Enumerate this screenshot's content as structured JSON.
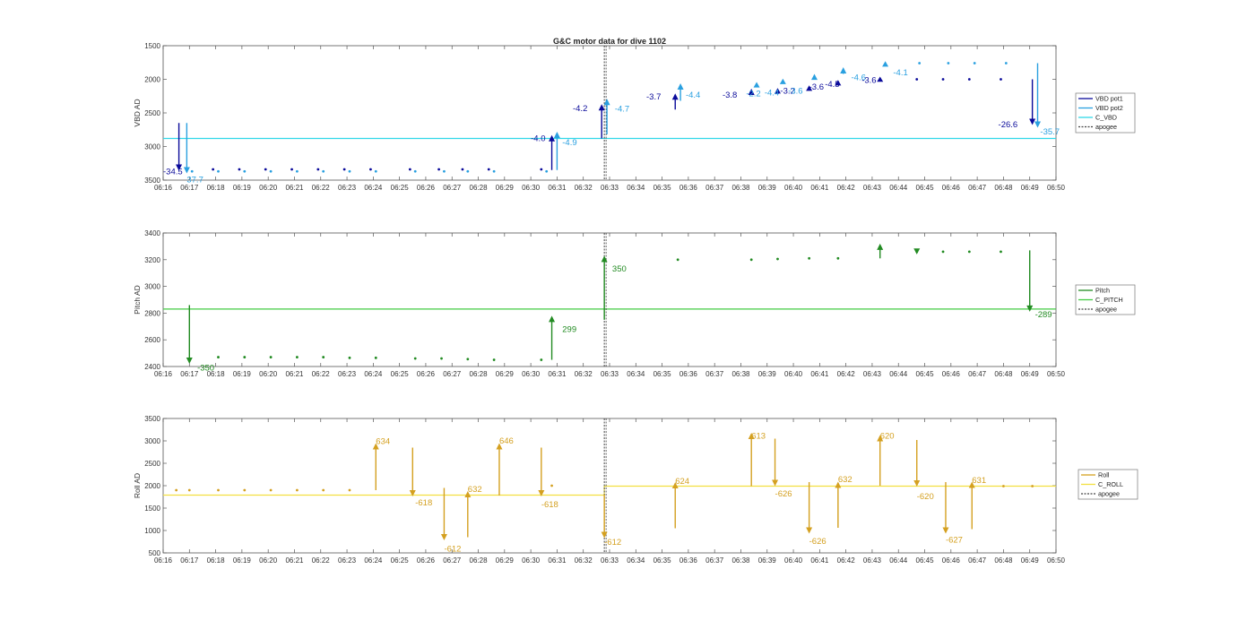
{
  "title": "G&C motor data for dive 1102",
  "time_ticks": [
    "06:16",
    "06:17",
    "06:18",
    "06:19",
    "06:20",
    "06:21",
    "06:22",
    "06:23",
    "06:24",
    "06:25",
    "06:26",
    "06:27",
    "06:28",
    "06:29",
    "06:30",
    "06:31",
    "06:32",
    "06:33",
    "06:34",
    "06:35",
    "06:36",
    "06:37",
    "06:38",
    "06:39",
    "06:40",
    "06:41",
    "06:42",
    "06:43",
    "06:44",
    "06:45",
    "06:46",
    "06:47",
    "06:48",
    "06:49",
    "06:50"
  ],
  "colors": {
    "vbd_pot1": "#0a0a9a",
    "vbd_pot2": "#2aa0e0",
    "c_vbd": "#30d8e8",
    "pitch": "#228b22",
    "c_pitch": "#44cc44",
    "roll": "#d4a020",
    "c_roll": "#f2e040",
    "apogee": "#444444"
  },
  "chart_data": [
    {
      "type": "line",
      "id": "vbd",
      "ylabel": "VBD AD",
      "ylim": [
        1500,
        3500
      ],
      "y_reversed": true,
      "yticks": [
        1500,
        2000,
        2500,
        3000,
        3500
      ],
      "xlim": [
        "06:16",
        "06:50"
      ],
      "apogee": "06:32.8",
      "legend": [
        "VBD pot1",
        "VBD pot2",
        "C_VBD",
        "apogee"
      ],
      "legend_placement": "right",
      "c_line": [
        {
          "x": "06:16",
          "y": 2880
        },
        {
          "x": "06:50",
          "y": 2880
        }
      ],
      "pot1_dots": [
        {
          "x": "06:16.9",
          "y": 3340
        },
        {
          "x": "06:17.9",
          "y": 3340
        },
        {
          "x": "06:18.9",
          "y": 3340
        },
        {
          "x": "06:19.9",
          "y": 3340
        },
        {
          "x": "06:20.9",
          "y": 3340
        },
        {
          "x": "06:21.9",
          "y": 3340
        },
        {
          "x": "06:22.9",
          "y": 3340
        },
        {
          "x": "06:23.9",
          "y": 3340
        },
        {
          "x": "06:25.4",
          "y": 3340
        },
        {
          "x": "06:26.5",
          "y": 3340
        },
        {
          "x": "06:27.4",
          "y": 3340
        },
        {
          "x": "06:28.4",
          "y": 3340
        },
        {
          "x": "06:30.4",
          "y": 3340
        },
        {
          "x": "06:38.4",
          "y": 2200
        },
        {
          "x": "06:39.4",
          "y": 2180
        },
        {
          "x": "06:40.6",
          "y": 2130
        },
        {
          "x": "06:41.7",
          "y": 2060
        },
        {
          "x": "06:43.3",
          "y": 2000
        },
        {
          "x": "06:44.7",
          "y": 2000
        },
        {
          "x": "06:45.7",
          "y": 2000
        },
        {
          "x": "06:46.7",
          "y": 2000
        },
        {
          "x": "06:47.9",
          "y": 2000
        }
      ],
      "pot2_dots": [
        {
          "x": "06:17.1",
          "y": 3370
        },
        {
          "x": "06:18.1",
          "y": 3370
        },
        {
          "x": "06:19.1",
          "y": 3370
        },
        {
          "x": "06:20.1",
          "y": 3370
        },
        {
          "x": "06:21.1",
          "y": 3370
        },
        {
          "x": "06:22.1",
          "y": 3370
        },
        {
          "x": "06:23.1",
          "y": 3370
        },
        {
          "x": "06:24.1",
          "y": 3370
        },
        {
          "x": "06:25.6",
          "y": 3370
        },
        {
          "x": "06:26.7",
          "y": 3370
        },
        {
          "x": "06:27.6",
          "y": 3370
        },
        {
          "x": "06:28.6",
          "y": 3370
        },
        {
          "x": "06:30.6",
          "y": 3370
        },
        {
          "x": "06:44.8",
          "y": 1760
        },
        {
          "x": "06:45.9",
          "y": 1760
        },
        {
          "x": "06:46.9",
          "y": 1760
        },
        {
          "x": "06:48.1",
          "y": 1760
        }
      ],
      "moves": [
        {
          "x": "06:16.6",
          "from": 2650,
          "to": 3360,
          "series": "pot1",
          "label": "-34.5",
          "lx": "06:16.0",
          "ly": 3370
        },
        {
          "x": "06:16.9",
          "from": 2650,
          "to": 3400,
          "series": "pot2",
          "label": "37.7",
          "lx": "06:16.9",
          "ly": 3490
        },
        {
          "x": "06:30.8",
          "from": 3350,
          "to": 2830,
          "series": "pot1",
          "label": "-4.0",
          "lx": "06:30.0",
          "ly": 2880
        },
        {
          "x": "06:31.0",
          "from": 3350,
          "to": 2780,
          "series": "pot2",
          "label": "-4.9",
          "lx": "06:31.2",
          "ly": 2940
        },
        {
          "x": "06:32.7",
          "from": 2880,
          "to": 2370,
          "series": "pot1",
          "label": "-4.2",
          "lx": "06:31.6",
          "ly": 2430
        },
        {
          "x": "06:32.9",
          "from": 2820,
          "to": 2290,
          "series": "pot2",
          "label": "-4.7",
          "lx": "06:33.2",
          "ly": 2440
        },
        {
          "x": "06:35.5",
          "from": 2450,
          "to": 2210,
          "series": "pot1",
          "label": "-3.7",
          "lx": "06:34.4",
          "ly": 2260
        },
        {
          "x": "06:35.7",
          "from": 2320,
          "to": 2060,
          "series": "pot2",
          "label": "-4.4",
          "lx": "06:35.9",
          "ly": 2230
        },
        {
          "x": "06:38.4",
          "from": 2230,
          "to": 2140,
          "series": "pot1",
          "label": "-3.8",
          "lx": "06:37.3",
          "ly": 2230
        },
        {
          "x": "06:38.6",
          "from": 2110,
          "to": 2040,
          "series": "pot2",
          "label": "-2.2",
          "lx": "06:38.2",
          "ly": 2210
        },
        {
          "x": "06:39.4",
          "from": 2200,
          "to": 2130,
          "series": "pot1",
          "label": "-3.2",
          "lx": "06:39.5",
          "ly": 2170
        },
        {
          "x": "06:39.6",
          "from": 2060,
          "to": 1990,
          "series": "pot2",
          "label": "-4.4",
          "lx": "06:38.9",
          "ly": 2200
        },
        {
          "x": "06:40.6",
          "from": 2160,
          "to": 2090,
          "series": "pot1",
          "label": "-3.6",
          "lx": "06:40.6",
          "ly": 2110
        },
        {
          "x": "06:40.8",
          "from": 2000,
          "to": 1920,
          "series": "pot2",
          "label": "-3.6",
          "lx": "06:39.8",
          "ly": 2170
        },
        {
          "x": "06:41.7",
          "from": 2080,
          "to": 2010,
          "series": "pot1",
          "label": "-4.5",
          "lx": "06:41.2",
          "ly": 2070
        },
        {
          "x": "06:41.9",
          "from": 1920,
          "to": 1820,
          "series": "pot2",
          "label": "-4.6",
          "lx": "06:42.2",
          "ly": 1970
        },
        {
          "x": "06:43.3",
          "from": 2020,
          "to": 1960,
          "series": "pot1",
          "label": "-3.6",
          "lx": "06:42.6",
          "ly": 2010
        },
        {
          "x": "06:43.5",
          "from": 1800,
          "to": 1730,
          "series": "pot2",
          "label": "-4.1",
          "lx": "06:43.8",
          "ly": 1900
        },
        {
          "x": "06:49.1",
          "from": 2000,
          "to": 2680,
          "series": "pot1",
          "label": "-26.6",
          "lx": "06:47.8",
          "ly": 2670
        },
        {
          "x": "06:49.3",
          "from": 1760,
          "to": 2720,
          "series": "pot2",
          "label": "-35.7",
          "lx": "06:49.4",
          "ly": 2780
        }
      ]
    },
    {
      "type": "line",
      "id": "pitch",
      "ylabel": "Pitch AD",
      "ylim": [
        2400,
        3400
      ],
      "y_reversed": false,
      "yticks": [
        2400,
        2600,
        2800,
        3000,
        3200,
        3400
      ],
      "xlim": [
        "06:16",
        "06:50"
      ],
      "apogee": "06:32.8",
      "legend": [
        "Pitch",
        "C_PITCH",
        "apogee"
      ],
      "legend_placement": "right",
      "c_line": [
        {
          "x": "06:16",
          "y": 2830
        },
        {
          "x": "06:50",
          "y": 2830
        }
      ],
      "dots": [
        {
          "x": "06:18.1",
          "y": 2470
        },
        {
          "x": "06:19.1",
          "y": 2470
        },
        {
          "x": "06:20.1",
          "y": 2470
        },
        {
          "x": "06:21.1",
          "y": 2470
        },
        {
          "x": "06:22.1",
          "y": 2470
        },
        {
          "x": "06:23.1",
          "y": 2465
        },
        {
          "x": "06:24.1",
          "y": 2465
        },
        {
          "x": "06:25.6",
          "y": 2460
        },
        {
          "x": "06:26.6",
          "y": 2460
        },
        {
          "x": "06:27.6",
          "y": 2455
        },
        {
          "x": "06:28.6",
          "y": 2450
        },
        {
          "x": "06:30.4",
          "y": 2450
        },
        {
          "x": "06:35.6",
          "y": 3200
        },
        {
          "x": "06:38.4",
          "y": 3200
        },
        {
          "x": "06:39.4",
          "y": 3205
        },
        {
          "x": "06:40.6",
          "y": 3210
        },
        {
          "x": "06:41.7",
          "y": 3210
        },
        {
          "x": "06:44.7",
          "y": 3260
        },
        {
          "x": "06:45.7",
          "y": 3260
        },
        {
          "x": "06:46.7",
          "y": 3260
        },
        {
          "x": "06:47.9",
          "y": 3260
        }
      ],
      "moves": [
        {
          "x": "06:17.0",
          "from": 2860,
          "to": 2420,
          "label": "-350",
          "lx": "06:17.3",
          "ly": 2390
        },
        {
          "x": "06:30.8",
          "from": 2450,
          "to": 2780,
          "label": "299",
          "lx": "06:31.2",
          "ly": 2680
        },
        {
          "x": "06:32.8",
          "from": 2750,
          "to": 3230,
          "label": "350",
          "lx": "06:33.1",
          "ly": 3130
        },
        {
          "x": "06:43.3",
          "from": 3210,
          "to": 3320,
          "label": "",
          "lx": "06:43.3",
          "ly": 3320
        },
        {
          "x": "06:44.7",
          "from": 3280,
          "to": 3240,
          "label": "",
          "lx": "06:44.7",
          "ly": 3240
        },
        {
          "x": "06:49.0",
          "from": 3270,
          "to": 2810,
          "label": "-289",
          "lx": "06:49.2",
          "ly": 2790
        }
      ]
    },
    {
      "type": "line",
      "id": "roll",
      "ylabel": "Roll AD",
      "ylim": [
        500,
        3500
      ],
      "y_reversed": false,
      "yticks": [
        500,
        1000,
        1500,
        2000,
        2500,
        3000,
        3500
      ],
      "xlim": [
        "06:16",
        "06:50"
      ],
      "apogee": "06:32.8",
      "legend": [
        "Roll",
        "C_ROLL",
        "apogee"
      ],
      "legend_placement": "right",
      "c_line": [
        {
          "x": "06:16",
          "y": 1790
        },
        {
          "x": "06:32.8",
          "y": 1790
        },
        {
          "x": "06:32.8",
          "y": 1990
        },
        {
          "x": "06:50",
          "y": 1990
        }
      ],
      "dots": [
        {
          "x": "06:16.5",
          "y": 1900
        },
        {
          "x": "06:17.0",
          "y": 1900
        },
        {
          "x": "06:18.1",
          "y": 1900
        },
        {
          "x": "06:19.1",
          "y": 1900
        },
        {
          "x": "06:20.1",
          "y": 1900
        },
        {
          "x": "06:21.1",
          "y": 1900
        },
        {
          "x": "06:22.1",
          "y": 1900
        },
        {
          "x": "06:23.1",
          "y": 1900
        },
        {
          "x": "06:30.8",
          "y": 2000
        },
        {
          "x": "06:48.0",
          "y": 1990
        },
        {
          "x": "06:49.1",
          "y": 1990
        }
      ],
      "moves": [
        {
          "x": "06:24.1",
          "from": 1900,
          "to": 2950,
          "label": "634",
          "lx": "06:24.1",
          "ly": 2990
        },
        {
          "x": "06:25.5",
          "from": 2850,
          "to": 1760,
          "label": "-618",
          "lx": "06:25.6",
          "ly": 1620
        },
        {
          "x": "06:26.7",
          "from": 1950,
          "to": 780,
          "label": "-612",
          "lx": "06:26.7",
          "ly": 590
        },
        {
          "x": "06:27.6",
          "from": 850,
          "to": 1880,
          "label": "632",
          "lx": "06:27.6",
          "ly": 1920
        },
        {
          "x": "06:28.8",
          "from": 1780,
          "to": 2950,
          "label": "646",
          "lx": "06:28.8",
          "ly": 3000
        },
        {
          "x": "06:30.4",
          "from": 2850,
          "to": 1760,
          "label": "-618",
          "lx": "06:30.4",
          "ly": 1580
        },
        {
          "x": "06:32.8",
          "from": 1800,
          "to": 830,
          "label": "-612",
          "lx": "06:32.8",
          "ly": 740
        },
        {
          "x": "06:35.5",
          "from": 1050,
          "to": 2080,
          "label": "624",
          "lx": "06:35.5",
          "ly": 2100
        },
        {
          "x": "06:38.4",
          "from": 1990,
          "to": 3180,
          "label": "613",
          "lx": "06:38.4",
          "ly": 3110
        },
        {
          "x": "06:39.3",
          "from": 3050,
          "to": 1990,
          "label": "-626",
          "lx": "06:39.3",
          "ly": 1820
        },
        {
          "x": "06:40.6",
          "from": 2080,
          "to": 930,
          "label": "-626",
          "lx": "06:40.6",
          "ly": 760
        },
        {
          "x": "06:41.7",
          "from": 1060,
          "to": 2090,
          "label": "632",
          "lx": "06:41.7",
          "ly": 2140
        },
        {
          "x": "06:43.3",
          "from": 2000,
          "to": 3130,
          "label": "620",
          "lx": "06:43.3",
          "ly": 3110
        },
        {
          "x": "06:44.7",
          "from": 3020,
          "to": 1980,
          "label": "-620",
          "lx": "06:44.7",
          "ly": 1760
        },
        {
          "x": "06:45.8",
          "from": 2080,
          "to": 930,
          "label": "-627",
          "lx": "06:45.8",
          "ly": 790
        },
        {
          "x": "06:46.8",
          "from": 1030,
          "to": 2090,
          "label": "631",
          "lx": "06:46.8",
          "ly": 2120
        }
      ]
    }
  ]
}
